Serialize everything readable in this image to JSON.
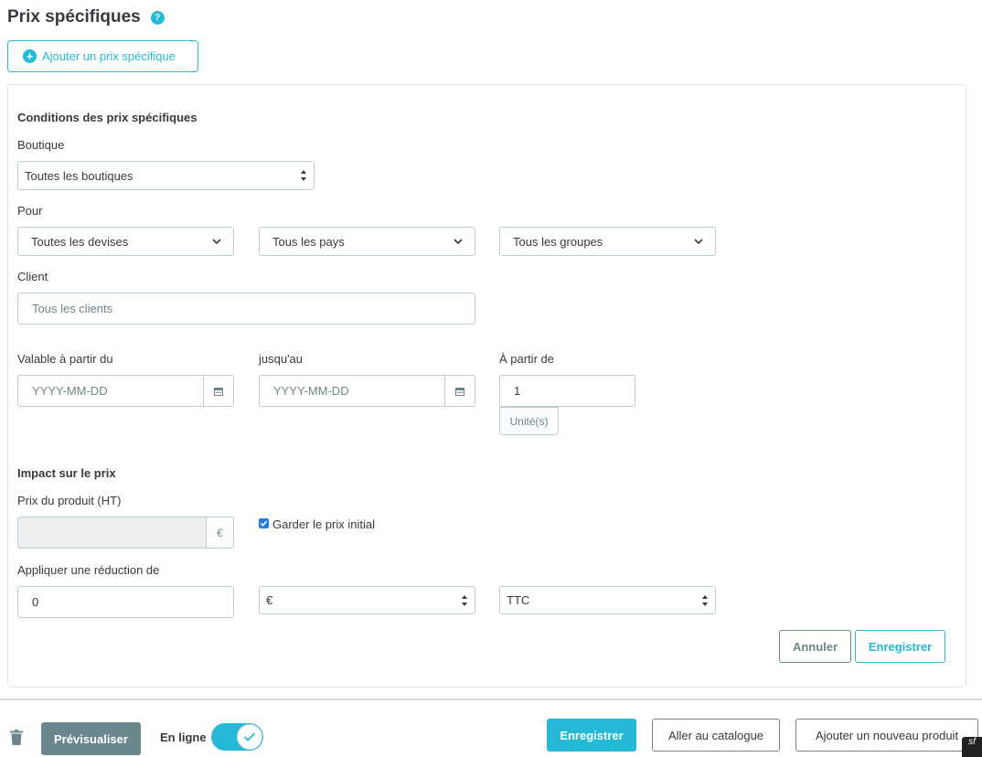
{
  "header": {
    "title": "Prix spécifiques",
    "help_glyph": "?",
    "add_button_label": "Ajouter un prix spécifique"
  },
  "conditions": {
    "title": "Conditions des prix spécifiques",
    "shop_label": "Boutique",
    "shop_value": "Toutes les boutiques",
    "for_label": "Pour",
    "currency_value": "Toutes les devises",
    "country_value": "Tous les pays",
    "group_value": "Tous les groupes",
    "client_label": "Client",
    "client_placeholder": "Tous les clients",
    "from_label": "Valable à partir du",
    "from_placeholder": "YYYY-MM-DD",
    "to_label": "jusqu'au",
    "to_placeholder": "YYYY-MM-DD",
    "qty_label": "À partir de",
    "qty_value": "1",
    "qty_unit": "Unité(s)"
  },
  "impact": {
    "title": "Impact sur le prix",
    "price_label": "Prix du produit (HT)",
    "price_value": "",
    "currency_symbol": "€",
    "keep_price_label": "Garder le prix initial",
    "keep_price_checked": true,
    "reduction_label": "Appliquer une réduction de",
    "reduction_value": "0",
    "reduction_type": "€",
    "tax_value": "TTC"
  },
  "form_actions": {
    "cancel_label": "Annuler",
    "save_label": "Enregistrer"
  },
  "footer": {
    "preview_label": "Prévisualiser",
    "online_label": "En ligne",
    "online_enabled": true,
    "save_label": "Enregistrer",
    "catalog_label": "Aller au catalogue",
    "new_product_label": "Ajouter un nouveau produit",
    "badge": "sf"
  },
  "colors": {
    "accent": "#25b9d7",
    "text": "#363a41",
    "muted": "#6c868e",
    "border": "#bbcdd2",
    "checkbox": "#1e7ee5"
  }
}
